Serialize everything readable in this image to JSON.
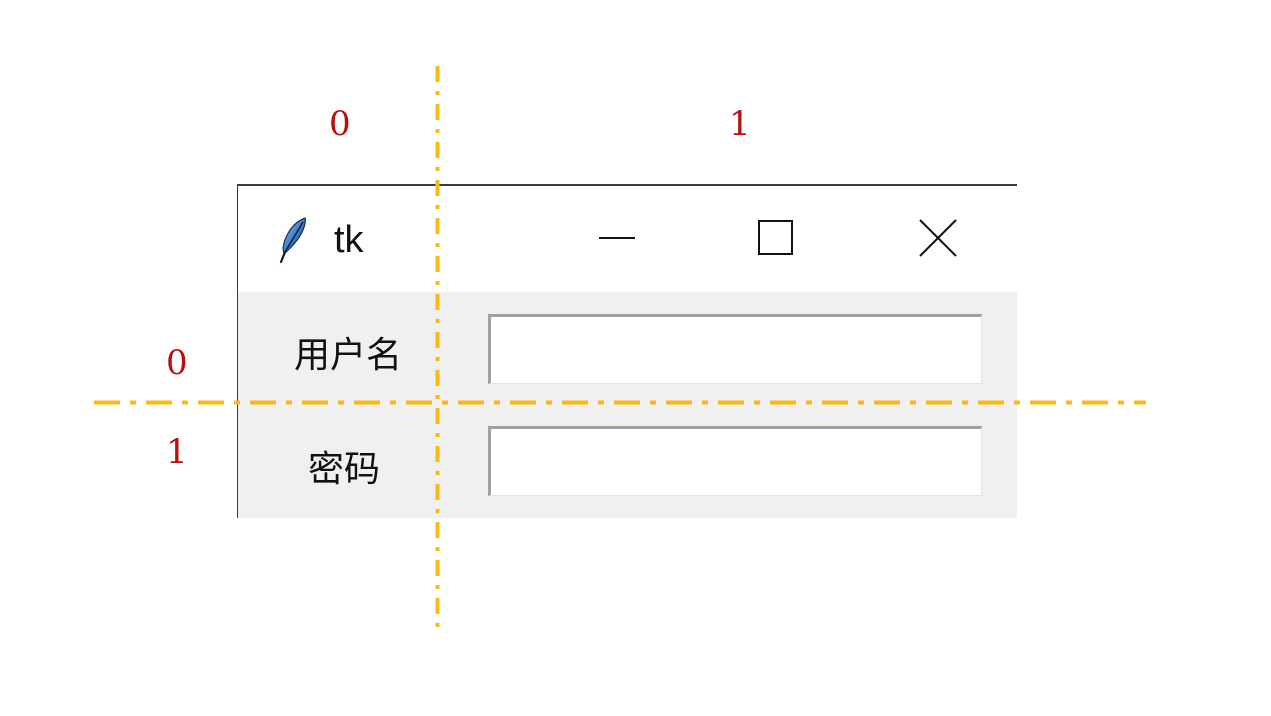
{
  "grid": {
    "column_indices": [
      "0",
      "1"
    ],
    "row_indices": [
      "0",
      "1"
    ],
    "guide_color": "#f7bc0f",
    "index_color": "#b80f0f"
  },
  "window": {
    "title": "tk",
    "icon": "feather-icon",
    "controls": {
      "minimize": "minimize-icon",
      "maximize": "maximize-icon",
      "close": "close-icon"
    }
  },
  "form": {
    "username_label": "用户名",
    "username_value": "",
    "password_label": "密码",
    "password_value": ""
  }
}
